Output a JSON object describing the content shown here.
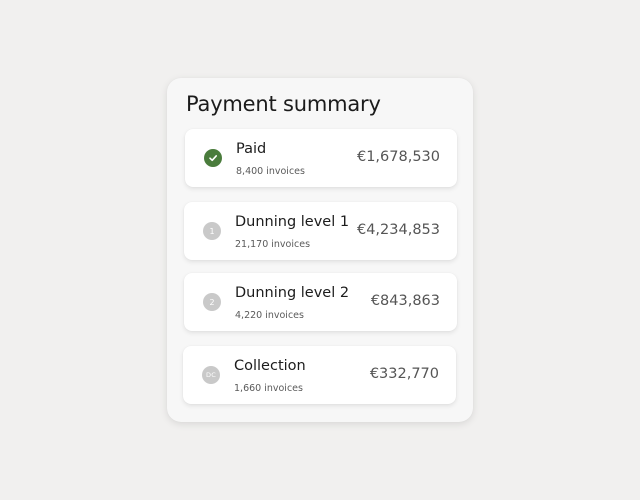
{
  "summary": {
    "title": "Payment summary",
    "rows": [
      {
        "name": "Paid",
        "count": "8,400 invoices",
        "amount": "€1,678,530",
        "icon": "check-circle-icon",
        "icon_color": "#4a7c3c"
      },
      {
        "name": "Dunning level 1",
        "count": "21,170 invoices",
        "amount": "€4,234,853",
        "icon": "level-1-badge-icon",
        "badge": "1",
        "icon_color": "#c9c9c9"
      },
      {
        "name": "Dunning level 2",
        "count": "4,220 invoices",
        "amount": "€843,863",
        "icon": "level-2-badge-icon",
        "badge": "2",
        "icon_color": "#c9c9c9"
      },
      {
        "name": "Collection",
        "count": "1,660 invoices",
        "amount": "€332,770",
        "icon": "collection-badge-icon",
        "badge": "DC",
        "icon_color": "#c9c9c9"
      }
    ]
  },
  "colors": {
    "background": "#f1f0ef",
    "panel": "#f7f7f7",
    "card": "#ffffff",
    "paid_accent": "#4a7c3c"
  }
}
